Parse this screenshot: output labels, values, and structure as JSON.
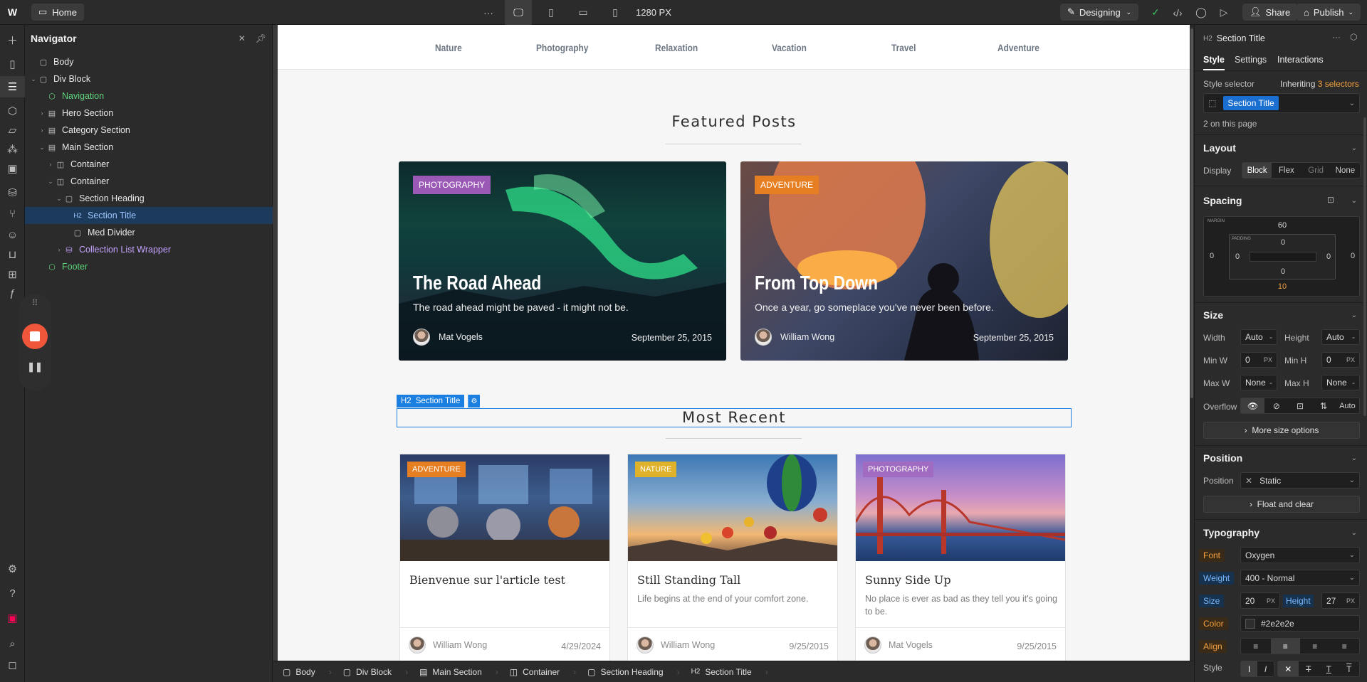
{
  "topbar": {
    "home_label": "Home",
    "more": "···",
    "width_label": "1280 PX",
    "mode_label": "Designing",
    "share_label": "Share",
    "publish_label": "Publish"
  },
  "navigator": {
    "title": "Navigator",
    "tree": [
      {
        "label": "Body"
      },
      {
        "label": "Div Block"
      },
      {
        "label": "Navigation"
      },
      {
        "label": "Hero Section"
      },
      {
        "label": "Category Section"
      },
      {
        "label": "Main Section"
      },
      {
        "label": "Container"
      },
      {
        "label": "Container"
      },
      {
        "label": "Section Heading"
      },
      {
        "label": "Section Title"
      },
      {
        "label": "Med Divider"
      },
      {
        "label": "Collection List Wrapper"
      },
      {
        "label": "Footer"
      }
    ]
  },
  "site": {
    "nav": [
      "Nature",
      "Photography",
      "Relaxation",
      "Vacation",
      "Travel",
      "Adventure"
    ],
    "featured_title": "Featured Posts",
    "featured": [
      {
        "badge": "PHOTOGRAPHY",
        "badge_color": "#9b59b6",
        "title": "The Road Ahead",
        "subtitle": "The road ahead might be paved - it might not be.",
        "author": "Mat Vogels",
        "date": "September 25, 2015"
      },
      {
        "badge": "ADVENTURE",
        "badge_color": "#e67e22",
        "title": "From Top Down",
        "subtitle": "Once a year, go someplace you've never been before.",
        "author": "William Wong",
        "date": "September 25, 2015"
      }
    ],
    "selected_tag": "Section Title",
    "selected_tag_prefix": "H2",
    "recent_title": "Most Recent",
    "recent": [
      {
        "badge": "ADVENTURE",
        "badge_color": "#e67e22",
        "title": "Bienvenue sur l'article test",
        "subtitle": "",
        "author": "William Wong",
        "date": "4/29/2024"
      },
      {
        "badge": "NATURE",
        "badge_color": "#e0b12a",
        "title": "Still Standing Tall",
        "subtitle": "Life begins at the end of your comfort zone.",
        "author": "William Wong",
        "date": "9/25/2015"
      },
      {
        "badge": "PHOTOGRAPHY",
        "badge_color": "#a06bc0",
        "title": "Sunny Side Up",
        "subtitle": "No place is ever as bad as they tell you it's going to be.",
        "author": "Mat Vogels",
        "date": "9/25/2015"
      }
    ]
  },
  "breadcrumb": [
    "Body",
    "Div Block",
    "Main Section",
    "Container",
    "Section Heading",
    "Section Title"
  ],
  "breadcrumb_last_prefix": "H2",
  "panel": {
    "element_prefix": "H2",
    "element_name": "Section Title",
    "tabs": [
      "Style",
      "Settings",
      "Interactions"
    ],
    "style_selector_label": "Style selector",
    "inheriting_prefix": "Inheriting",
    "inheriting_count": "3 selectors",
    "selector_chip": "Section Title",
    "on_page": "2 on this page",
    "layout": {
      "title": "Layout",
      "display_label": "Display",
      "options": [
        "Block",
        "Flex",
        "Grid",
        "None"
      ]
    },
    "spacing": {
      "title": "Spacing",
      "margin_label": "MARGIN",
      "padding_label": "PADDING",
      "margin_top": "60",
      "margin_left": "0",
      "margin_right": "0",
      "margin_bottom": "10",
      "pad_top": "0",
      "pad_left": "0",
      "pad_right": "0",
      "pad_bottom": "0"
    },
    "size": {
      "title": "Size",
      "width_label": "Width",
      "width": "Auto",
      "height_label": "Height",
      "height": "Auto",
      "minw_label": "Min W",
      "minw": "0",
      "minh_label": "Min H",
      "minh": "0",
      "maxw_label": "Max W",
      "maxw": "None",
      "maxh_label": "Max H",
      "maxh": "None",
      "overflow_label": "Overflow",
      "overflow_auto": "Auto",
      "unit_px": "PX",
      "unit_dash": "-",
      "more": "More size options"
    },
    "position": {
      "title": "Position",
      "label": "Position",
      "value": "Static",
      "float": "Float and clear"
    },
    "typography": {
      "title": "Typography",
      "font_label": "Font",
      "font": "Oxygen",
      "weight_label": "Weight",
      "weight": "400 - Normal",
      "size_label": "Size",
      "size": "20",
      "height_label": "Height",
      "height": "27",
      "unit": "PX",
      "color_label": "Color",
      "color": "#2e2e2e",
      "align_label": "Align",
      "style_label": "Style",
      "style_i": "I",
      "style_it": "I"
    }
  }
}
